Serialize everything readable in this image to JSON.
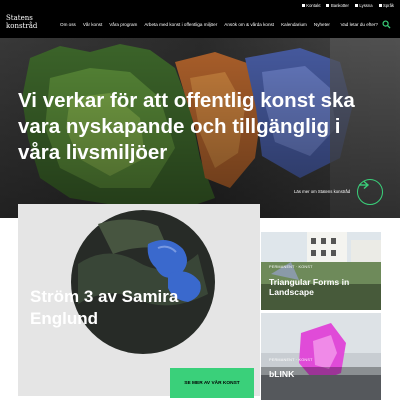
{
  "utility_bar": {
    "items": [
      {
        "label": "Kontakt",
        "icon": "envelope-icon"
      },
      {
        "label": "Bankotter",
        "icon": "image-icon"
      },
      {
        "label": "Lyssna",
        "icon": "speaker-icon"
      },
      {
        "label": "Språk",
        "icon": "globe-icon"
      }
    ]
  },
  "header": {
    "logo_line1": "Statens",
    "logo_line2": "konstråd",
    "nav": [
      "Om oss",
      "Vår konst",
      "Våra program",
      "Arbeta med konst i offentliga miljöer",
      "Ansök om & vårda konst",
      "Kalendarium",
      "Nyheter"
    ],
    "search_label": "Vad letar du efter?",
    "search_icon": "search-icon"
  },
  "hero": {
    "title": "Vi verkar för att offentlig konst ska vara nyskapande och tillgänglig i våra livsmiljöer",
    "link_label": "Läs mer om Statens konstråd",
    "arrow_icon": "arrow-right-icon"
  },
  "feature": {
    "title": "Ström 3 av Samira Englund",
    "cta_label": "SE MER AV VÅR KONST"
  },
  "cards": [
    {
      "kicker": "PERMANENT · KONST",
      "title": "Triangular Forms in Landscape"
    },
    {
      "kicker": "PERMANENT · KONST",
      "title": "bLINK"
    }
  ],
  "colors": {
    "accent_green": "#3ad07a",
    "header_bg": "#000000"
  }
}
